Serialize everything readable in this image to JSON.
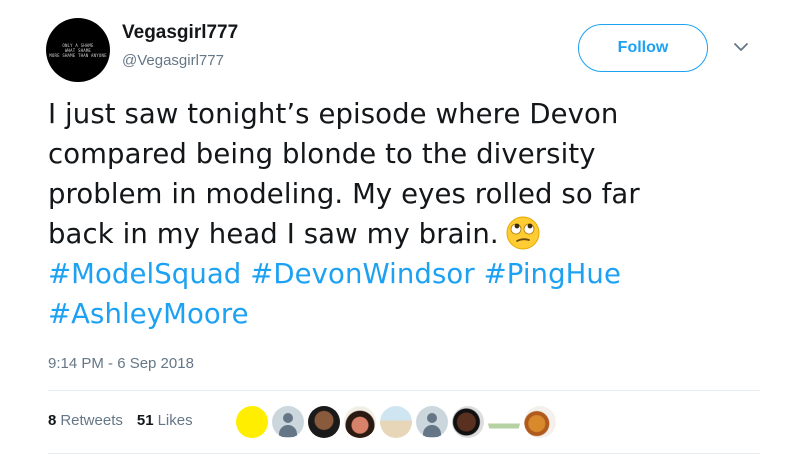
{
  "user": {
    "display_name": "Vegasgirl777",
    "handle": "@Vegasgirl777",
    "avatar_text": [
      "ONLY A SHAME",
      "WHAT SHAME",
      "MORE SHAME THAN ANYONE"
    ]
  },
  "follow_button": {
    "label": "Follow"
  },
  "caret_icon": "chevron-down-icon",
  "tweet": {
    "lines": [
      "I just saw tonight’s episode where Devon",
      "compared being blonde to the diversity",
      "problem in modeling. My eyes rolled so far",
      "back in my head I saw my brain."
    ],
    "emoji": "face-with-rolling-eyes",
    "hashtags_line1": [
      "#ModelSquad",
      "#DevonWindsor",
      "#PingHue"
    ],
    "hashtags_line2": [
      "#AshleyMoore"
    ]
  },
  "timestamp": "9:14 PM - 6 Sep 2018",
  "stats": {
    "retweets_count": "8",
    "retweets_label": "Retweets",
    "likes_count": "51",
    "likes_label": "Likes"
  },
  "liker_count_shown": 9,
  "colors": {
    "accent": "#1da1f2",
    "text": "#14171a",
    "muted": "#657786",
    "divider": "#e6ecf0"
  }
}
